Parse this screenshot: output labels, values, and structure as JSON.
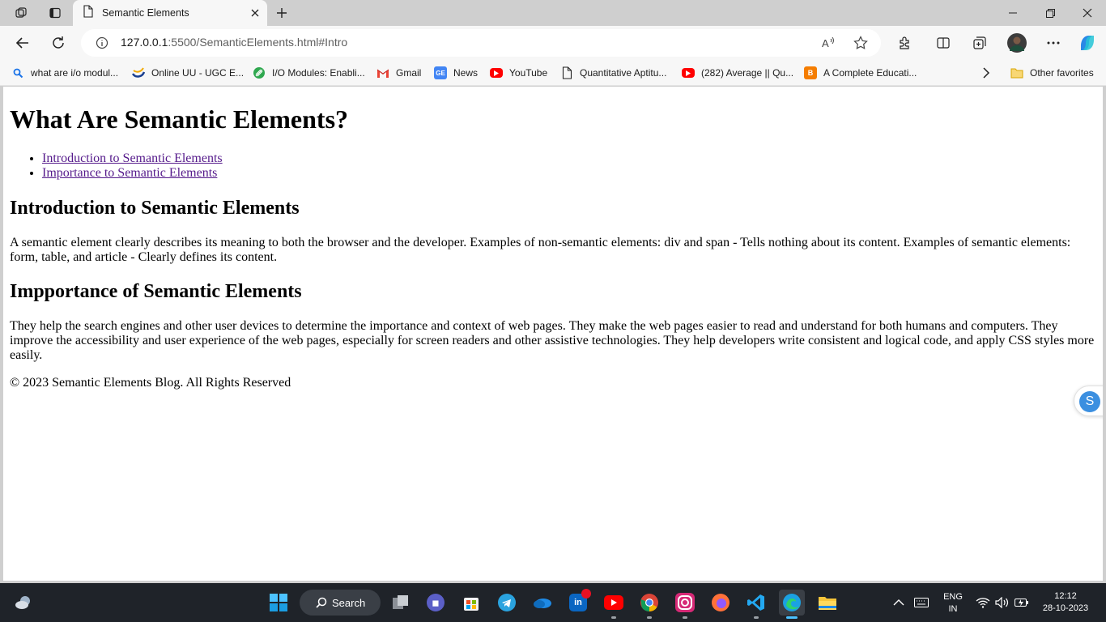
{
  "browser": {
    "tab": {
      "title": "Semantic Elements"
    },
    "url_host": "127.0.0.1",
    "url_rest": ":5500/SemanticElements.html#Intro"
  },
  "favorites": [
    {
      "label": "what are i/o modul...",
      "icon": "search-icon"
    },
    {
      "label": "Online UU - UGC E...",
      "icon": "uu-logo-icon"
    },
    {
      "label": "I/O Modules: Enabli...",
      "icon": "leaf-logo-icon"
    },
    {
      "label": "Gmail",
      "icon": "gmail-icon"
    },
    {
      "label": "News",
      "icon": "news-icon"
    },
    {
      "label": "YouTube",
      "icon": "youtube-icon"
    },
    {
      "label": "Quantitative Aptitu...",
      "icon": "page-icon"
    },
    {
      "label": "(282) Average || Qu...",
      "icon": "youtube-icon"
    },
    {
      "label": "A Complete Educati...",
      "icon": "blogger-icon"
    }
  ],
  "other_favorites": "Other favorites",
  "page": {
    "h1": "What Are Semantic Elements?",
    "nav_links": [
      "Introduction to Semantic Elements",
      "Importance to Semantic Elements"
    ],
    "sections": [
      {
        "heading": "Introduction to Semantic Elements",
        "body": "A semantic element clearly describes its meaning to both the browser and the developer. Examples of non-semantic elements: div and span - Tells nothing about its content. Examples of semantic elements: form, table, and article - Clearly defines its content."
      },
      {
        "heading": "Impportance of Semantic Elements",
        "body": "They help the search engines and other user devices to determine the importance and context of web pages. They make the web pages easier to read and understand for both humans and computers. They improve the accessibility and user experience of the web pages, especially for screen readers and other assistive technologies. They help developers write consistent and logical code, and apply CSS styles more easily."
      }
    ],
    "footer": "© 2023 Semantic Elements Blog. All Rights Reserved",
    "floating_badge": "S"
  },
  "taskbar": {
    "search_label": "Search",
    "lang_top": "ENG",
    "lang_bottom": "IN",
    "time": "12:12",
    "date": "28-10-2023"
  }
}
